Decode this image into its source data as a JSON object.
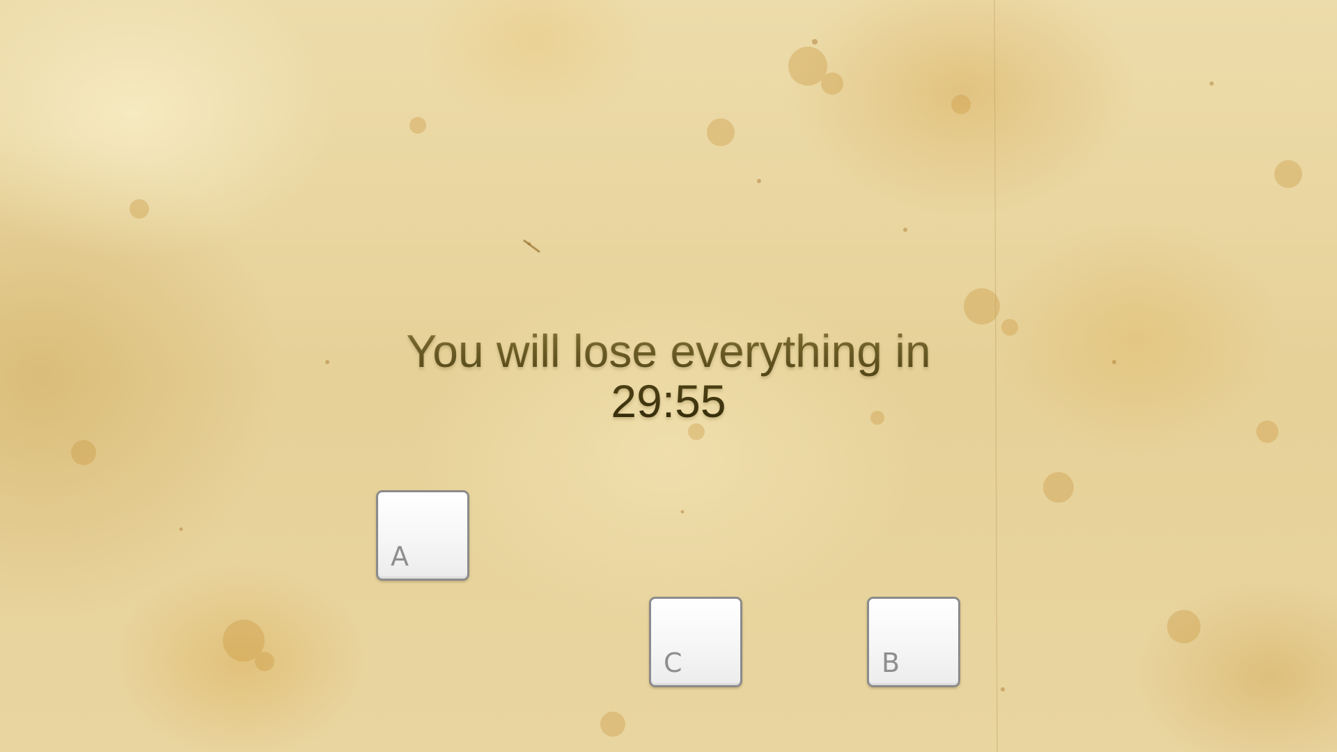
{
  "message": {
    "line1": "You will lose everything in",
    "timer": "29:55"
  },
  "keys": [
    {
      "label": "A"
    },
    {
      "label": "C"
    },
    {
      "label": "B"
    }
  ],
  "colors": {
    "parchment": "#e9d6a1",
    "text_top": "#8a7a3c",
    "text_bottom": "#2b2408",
    "key_face": "#f6f6f6",
    "key_border": "#8b8b8b",
    "key_label": "#8e8e8e"
  }
}
